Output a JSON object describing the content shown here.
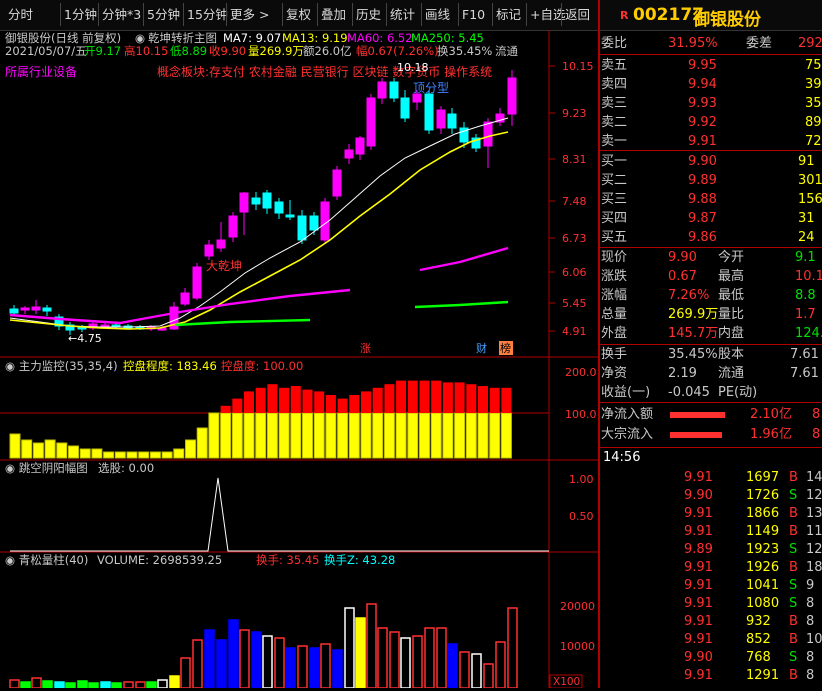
{
  "toolbar": {
    "items": [
      "分时",
      "1分钟",
      "分钟*3",
      "5分钟",
      "15分钟",
      "更多 >",
      "复权",
      "叠加",
      "历史",
      "统计",
      "画线",
      "F10",
      "标记",
      "+自选",
      "返回"
    ],
    "code": "002177",
    "name": "御银股份",
    "flag": "R"
  },
  "header": {
    "line1_title": "御银股份(日线 前复权)",
    "indicator": "乾坤转折主图",
    "ma7": "MA7: 9.07",
    "ma13": "MA13: 9.19",
    "ma60": "MA60: 6.52",
    "ma250": "MA250: 5.45",
    "date": "2021/05/07/五",
    "open": "开9.17",
    "high": "高10.15",
    "low": "低8.89",
    "close": "收9.90",
    "volume": "量269.9万",
    "amount": "额26.0亿",
    "change": "幅0.67(7.26%)",
    "turnover": "换35.45%",
    "float": "流通",
    "industry": "所属行业设备",
    "concepts": "概念板块:存支付 农村金融 民营银行 区块链 数字货币 操作系统"
  },
  "main_chart": {
    "price_axis": [
      "10.15",
      "9.23",
      "8.31",
      "7.48",
      "6.73",
      "6.06",
      "5.45",
      "4.91"
    ],
    "annot_max": "10.18",
    "annot_min": "4.75",
    "label_a": "大乾坤",
    "label_b": "顶分型",
    "marker_zhang": "涨",
    "marker_cai": "财",
    "marker_bang": "榜"
  },
  "panel2": {
    "title": "主力监控(35,35,4)",
    "val_label": "控盘程度: 183.46",
    "val_label2": "控盘度: 100.00",
    "axis": [
      "200.0",
      "100.0"
    ]
  },
  "panel3": {
    "title": "跳空阴阳幅图",
    "sel": "选股: 0.00",
    "axis": [
      "1.00",
      "0.50"
    ]
  },
  "panel4": {
    "title": "青松量柱(40)",
    "volume": "VOLUME: 2698539.25",
    "huanshou": "换手: 35.45",
    "huanshouz": "换手Z: 43.28",
    "axis": [
      "20000",
      "10000"
    ],
    "unit": "X100"
  },
  "right": {
    "webi_label": "委比",
    "webi_val": "31.95%",
    "weicha_label": "委差",
    "weicha_val": "292",
    "asks": [
      {
        "label": "卖五",
        "price": "9.95",
        "vol": "75"
      },
      {
        "label": "卖四",
        "price": "9.94",
        "vol": "39"
      },
      {
        "label": "卖三",
        "price": "9.93",
        "vol": "35"
      },
      {
        "label": "卖二",
        "price": "9.92",
        "vol": "89"
      },
      {
        "label": "卖一",
        "price": "9.91",
        "vol": "72"
      }
    ],
    "bids": [
      {
        "label": "买一",
        "price": "9.90",
        "vol": "91"
      },
      {
        "label": "买二",
        "price": "9.89",
        "vol": "301"
      },
      {
        "label": "买三",
        "price": "9.88",
        "vol": "156"
      },
      {
        "label": "买四",
        "price": "9.87",
        "vol": "31"
      },
      {
        "label": "买五",
        "price": "9.86",
        "vol": "24"
      }
    ],
    "stats": [
      {
        "l1": "现价",
        "v1": "9.90",
        "l2": "今开",
        "v2": "9.1"
      },
      {
        "l1": "涨跌",
        "v1": "0.67",
        "l2": "最高",
        "v2": "10.1"
      },
      {
        "l1": "涨幅",
        "v1": "7.26%",
        "l2": "最低",
        "v2": "8.8"
      },
      {
        "l1": "总量",
        "v1": "269.9万",
        "l2": "量比",
        "v2": "1.7"
      },
      {
        "l1": "外盘",
        "v1": "145.7万",
        "l2": "内盘",
        "v2": "124.1"
      }
    ],
    "stats2": [
      {
        "l1": "换手",
        "v1": "35.45%",
        "l2": "股本",
        "v2": "7.61"
      },
      {
        "l1": "净资",
        "v1": "2.19",
        "l2": "流通",
        "v2": "7.61"
      },
      {
        "l1": "收益(一)",
        "v1": "-0.045",
        "l2": "PE(动)",
        "v2": ""
      }
    ],
    "flow": [
      {
        "label": "净流入额",
        "val": "2.10亿",
        "end": "8"
      },
      {
        "label": "大宗流入",
        "val": "1.96亿",
        "end": "8"
      }
    ],
    "trade_time": "14:56",
    "trades": [
      {
        "p": "9.91",
        "v": "1697",
        "d": "B",
        "n": "14"
      },
      {
        "p": "9.90",
        "v": "1726",
        "d": "S",
        "n": "12"
      },
      {
        "p": "9.91",
        "v": "1866",
        "d": "B",
        "n": "13"
      },
      {
        "p": "9.91",
        "v": "1149",
        "d": "B",
        "n": "11"
      },
      {
        "p": "9.89",
        "v": "1923",
        "d": "S",
        "n": "12"
      },
      {
        "p": "9.91",
        "v": "1926",
        "d": "B",
        "n": "18"
      },
      {
        "p": "9.91",
        "v": "1041",
        "d": "S",
        "n": "9"
      },
      {
        "p": "9.91",
        "v": "1080",
        "d": "S",
        "n": "8"
      },
      {
        "p": "9.91",
        "v": "932",
        "d": "B",
        "n": "8"
      },
      {
        "p": "9.91",
        "v": "852",
        "d": "B",
        "n": "10"
      },
      {
        "p": "9.90",
        "v": "768",
        "d": "S",
        "n": "8"
      },
      {
        "p": "9.91",
        "v": "1291",
        "d": "B",
        "n": "8"
      }
    ]
  },
  "colors": {
    "up": "#ff2020",
    "down": "#00ffff",
    "text_red": "#ff3030",
    "text_green": "#00e000",
    "yellow": "#ffff00",
    "magenta": "#ff00ff"
  }
}
